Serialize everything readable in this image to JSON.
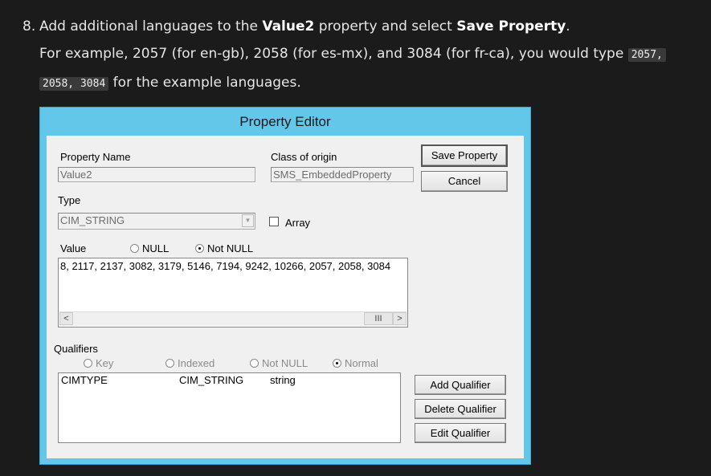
{
  "instruction": {
    "number": "8.",
    "line1_pre": "Add additional languages to the ",
    "line1_bold1": "Value2",
    "line1_mid": " property and select ",
    "line1_bold2": "Save Property",
    "line1_post": ".",
    "line2_text": "For example, 2057 (for en-gb), 2058 (for es-mx), and 3084 (for fr-ca), you would type ",
    "code_part1": "2057,",
    "code_part2": "2058, 3084",
    "line3_text": " for the example languages."
  },
  "dialog": {
    "title": "Property Editor",
    "property_name_label": "Property Name",
    "property_name_value": "Value2",
    "class_origin_label": "Class of origin",
    "class_origin_value": "SMS_EmbeddedProperty",
    "save_button": "Save Property",
    "cancel_button": "Cancel",
    "type_label": "Type",
    "type_value": "CIM_STRING",
    "array_label": "Array",
    "array_checked": false,
    "value_label": "Value",
    "null_label": "NULL",
    "not_null_label": "Not NULL",
    "value_text": "8, 2117, 2137, 3082, 3179, 5146, 7194, 9242, 10266, 2057, 2058, 3084",
    "qualifiers_label": "Qualifiers",
    "qual_key": "Key",
    "qual_indexed": "Indexed",
    "qual_notnull": "Not NULL",
    "qual_normal": "Normal",
    "qualifier_rows": [
      {
        "name": "CIMTYPE",
        "type": "CIM_STRING",
        "value": "string"
      }
    ],
    "add_qualifier": "Add Qualifier",
    "delete_qualifier": "Delete Qualifier",
    "edit_qualifier": "Edit Qualifier"
  }
}
